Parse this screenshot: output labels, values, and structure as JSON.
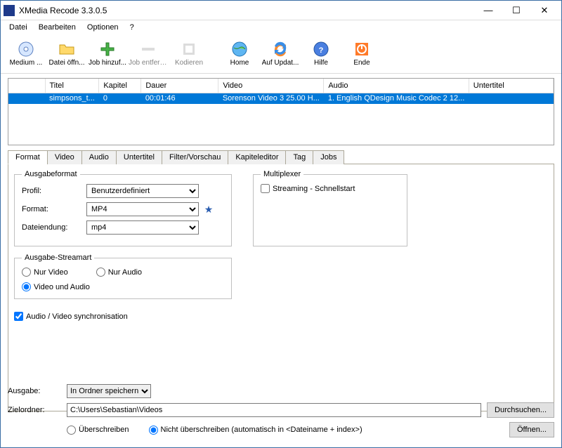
{
  "window": {
    "title": "XMedia Recode 3.3.0.5"
  },
  "menu": {
    "datei": "Datei",
    "bearbeiten": "Bearbeiten",
    "optionen": "Optionen",
    "hilfe": "?"
  },
  "toolbar": {
    "medium": "Medium ...",
    "datei": "Datei öffn...",
    "jobadd": "Job hinzuf...",
    "jobrem": "Job entfern...",
    "kodieren": "Kodieren",
    "home": "Home",
    "update": "Auf Updat...",
    "hilfe": "Hilfe",
    "ende": "Ende"
  },
  "table": {
    "headers": {
      "titel": "Titel",
      "kapitel": "Kapitel",
      "dauer": "Dauer",
      "video": "Video",
      "audio": "Audio",
      "untertitel": "Untertitel"
    },
    "rows": [
      {
        "titel": "simpsons_t...",
        "kapitel": "0",
        "dauer": "00:01:46",
        "video": "Sorenson Video 3 25.00 H...",
        "audio": "1. English QDesign Music Codec 2 12...",
        "untertitel": ""
      }
    ]
  },
  "tabs": {
    "format": "Format",
    "video": "Video",
    "audio": "Audio",
    "untertitel": "Untertitel",
    "filter": "Filter/Vorschau",
    "kapitel": "Kapiteleditor",
    "tag": "Tag",
    "jobs": "Jobs"
  },
  "format_tab": {
    "ausgabeformat_legend": "Ausgabeformat",
    "profil_label": "Profil:",
    "profil_value": "Benutzerdefiniert",
    "format_label": "Format:",
    "format_value": "MP4",
    "ext_label": "Dateiendung:",
    "ext_value": "mp4",
    "multiplexer_legend": "Multiplexer",
    "streaming_label": "Streaming - Schnellstart",
    "streamart_legend": "Ausgabe-Streamart",
    "nur_video": "Nur Video",
    "nur_audio": "Nur Audio",
    "video_und_audio": "Video und Audio",
    "avsync": "Audio / Video synchronisation"
  },
  "bottom": {
    "ausgabe_label": "Ausgabe:",
    "ausgabe_value": "In Ordner speichern",
    "zielordner_label": "Zielordner:",
    "zielordner_value": "C:\\Users\\Sebastian\\Videos",
    "durchsuchen": "Durchsuchen...",
    "oeffnen": "Öffnen...",
    "ueberschreiben": "Überschreiben",
    "nicht_ueberschreiben": "Nicht überschreiben (automatisch in <Dateiname + index>)"
  }
}
